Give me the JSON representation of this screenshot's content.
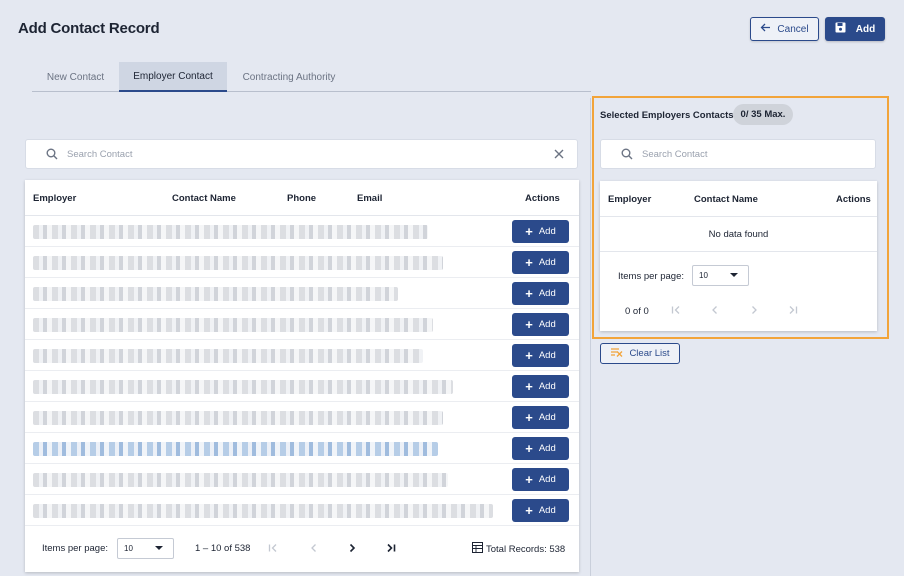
{
  "page_title": "Add Contact Record",
  "header": {
    "cancel_label": "Cancel",
    "add_label": "Add"
  },
  "tabs": [
    {
      "label": "New Contact",
      "active": false
    },
    {
      "label": "Employer Contact",
      "active": true
    },
    {
      "label": "Contracting Authority",
      "active": false
    }
  ],
  "left": {
    "search_placeholder": "Search Contact",
    "columns": {
      "employer": "Employer",
      "contact_name": "Contact Name",
      "phone": "Phone",
      "email": "Email",
      "actions": "Actions"
    },
    "row_add_label": "Add",
    "rows_count": 10,
    "pager": {
      "items_per_page_label": "Items per page:",
      "page_size": "10",
      "range": "1 – 10 of 538",
      "total": "Total Records: 538"
    }
  },
  "right": {
    "title": "Selected Employers Contacts:",
    "badge": "0/ 35 Max.",
    "search_placeholder": "Search Contact",
    "columns": {
      "employer": "Employer",
      "contact_name": "Contact Name",
      "actions": "Actions"
    },
    "no_data": "No data found",
    "pager": {
      "items_per_page_label": "Items per page:",
      "page_size": "10",
      "range": "0 of 0"
    },
    "clear_label": "Clear List"
  },
  "colors": {
    "primary": "#2b4a8b",
    "highlight_border": "#f2a43a",
    "background": "#e4e8f1"
  }
}
